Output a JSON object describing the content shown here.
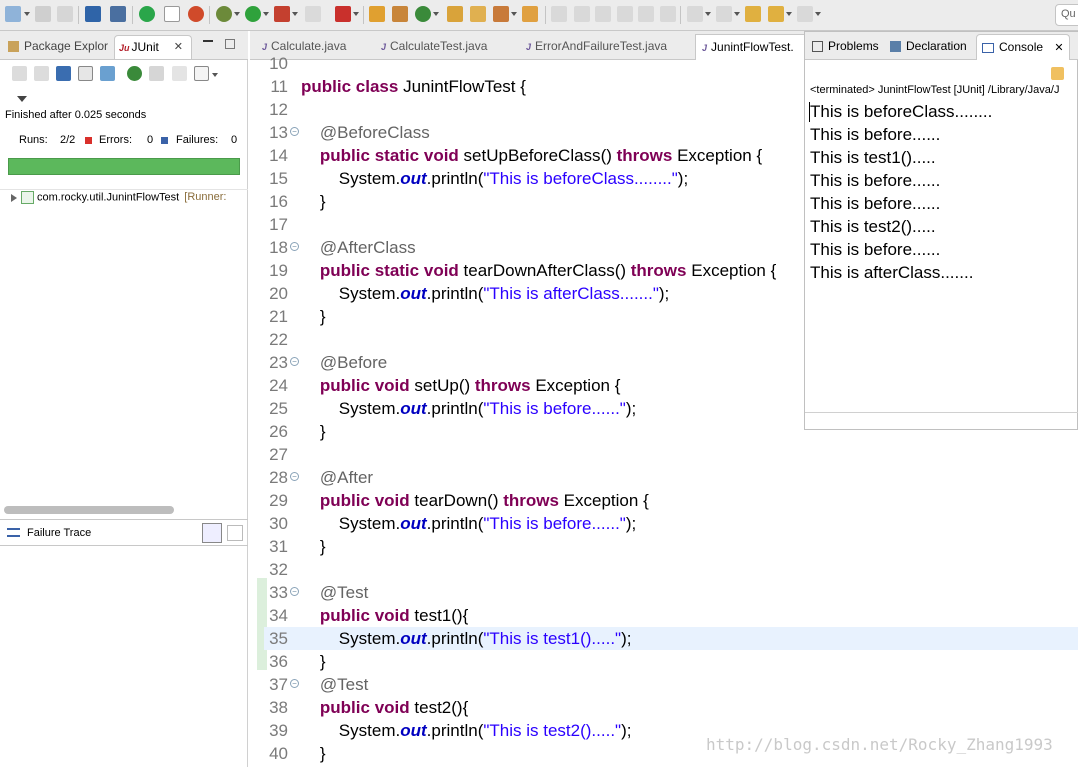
{
  "toolbar": {
    "quick_access": "Qu"
  },
  "left_panel": {
    "tabs": [
      {
        "label": "Package Explor"
      },
      {
        "label": "JUnit"
      }
    ],
    "status_text": "Finished after 0.025 seconds",
    "runs_label": "Runs:",
    "runs_value": "2/2",
    "errors_label": "Errors:",
    "errors_value": "0",
    "failures_label": "Failures:",
    "failures_value": "0",
    "progress_fraction": 1.0,
    "progress_color": "#5cb85c",
    "tree_item": "com.rocky.util.JunintFlowTest",
    "tree_item_runner": "[Runner:",
    "failure_trace_label": "Failure Trace"
  },
  "editor": {
    "tabs": [
      {
        "label": "Calculate.java"
      },
      {
        "label": "CalculateTest.java"
      },
      {
        "label": "ErrorAndFailureTest.java"
      },
      {
        "label": "JunintFlowTest."
      }
    ],
    "highlighted_line": "35",
    "lines": [
      {
        "num": "10",
        "fold": false,
        "code": ""
      },
      {
        "num": "11",
        "fold": false,
        "code": "public class JunintFlowTest {"
      },
      {
        "num": "12",
        "fold": false,
        "code": ""
      },
      {
        "num": "13",
        "fold": true,
        "code": "    @BeforeClass"
      },
      {
        "num": "14",
        "fold": false,
        "code": "    public static void setUpBeforeClass() throws Exception {"
      },
      {
        "num": "15",
        "fold": false,
        "code": "        System.out.println(\"This is beforeClass........\");"
      },
      {
        "num": "16",
        "fold": false,
        "code": "    }"
      },
      {
        "num": "17",
        "fold": false,
        "code": ""
      },
      {
        "num": "18",
        "fold": true,
        "code": "    @AfterClass"
      },
      {
        "num": "19",
        "fold": false,
        "code": "    public static void tearDownAfterClass() throws Exception {"
      },
      {
        "num": "20",
        "fold": false,
        "code": "        System.out.println(\"This is afterClass.......\");"
      },
      {
        "num": "21",
        "fold": false,
        "code": "    }"
      },
      {
        "num": "22",
        "fold": false,
        "code": ""
      },
      {
        "num": "23",
        "fold": true,
        "code": "    @Before"
      },
      {
        "num": "24",
        "fold": false,
        "code": "    public void setUp() throws Exception {"
      },
      {
        "num": "25",
        "fold": false,
        "code": "        System.out.println(\"This is before......\");"
      },
      {
        "num": "26",
        "fold": false,
        "code": "    }"
      },
      {
        "num": "27",
        "fold": false,
        "code": ""
      },
      {
        "num": "28",
        "fold": true,
        "code": "    @After"
      },
      {
        "num": "29",
        "fold": false,
        "code": "    public void tearDown() throws Exception {"
      },
      {
        "num": "30",
        "fold": false,
        "code": "        System.out.println(\"This is before......\");"
      },
      {
        "num": "31",
        "fold": false,
        "code": "    }"
      },
      {
        "num": "32",
        "fold": false,
        "code": ""
      },
      {
        "num": "33",
        "fold": true,
        "code": "    @Test"
      },
      {
        "num": "34",
        "fold": false,
        "code": "    public void test1(){"
      },
      {
        "num": "35",
        "fold": false,
        "code": "        System.out.println(\"This is test1().....\");"
      },
      {
        "num": "36",
        "fold": false,
        "code": "    }"
      },
      {
        "num": "37",
        "fold": true,
        "code": "    @Test"
      },
      {
        "num": "38",
        "fold": false,
        "code": "    public void test2(){"
      },
      {
        "num": "39",
        "fold": false,
        "code": "        System.out.println(\"This is test2().....\");"
      },
      {
        "num": "40",
        "fold": false,
        "code": "    }"
      }
    ]
  },
  "right_panel": {
    "tabs": [
      {
        "label": "Problems"
      },
      {
        "label": "Declaration"
      },
      {
        "label": "Console"
      }
    ],
    "terminated_text": "<terminated> JunintFlowTest [JUnit] /Library/Java/J",
    "console_lines": [
      "This is beforeClass........",
      "This is before......",
      "This is test1().....",
      "This is before......",
      "This is before......",
      "This is test2().....",
      "This is before......",
      "This is afterClass......."
    ]
  },
  "watermark": "http://blog.csdn.net/Rocky_Zhang1993"
}
